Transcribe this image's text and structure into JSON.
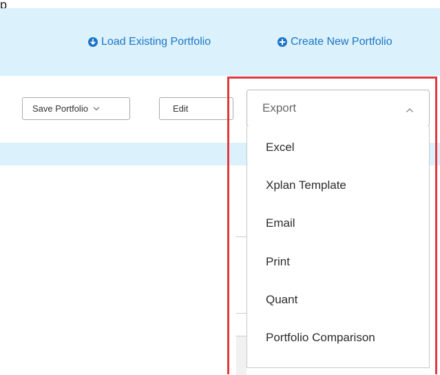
{
  "top_left_fragment": "p",
  "header": {
    "load_label": "Load Existing Portfolio",
    "create_label": "Create New Portfolio"
  },
  "toolbar": {
    "save_label": "Save Portfolio",
    "edit_label": "Edit",
    "export_label": "Export"
  },
  "export_menu": {
    "items": [
      {
        "label": "Excel"
      },
      {
        "label": "Xplan Template"
      },
      {
        "label": "Email"
      },
      {
        "label": "Print"
      },
      {
        "label": "Quant"
      },
      {
        "label": "Portfolio Comparison"
      }
    ]
  },
  "colors": {
    "link_blue": "#1a74c6",
    "header_bg": "#dbf1fc",
    "highlight_red": "#e0383e"
  },
  "icons": {
    "load": "circle-down-arrow-icon",
    "create": "circle-plus-icon",
    "save_dropdown": "chevron-down-icon",
    "export_toggle": "chevron-up-icon"
  }
}
